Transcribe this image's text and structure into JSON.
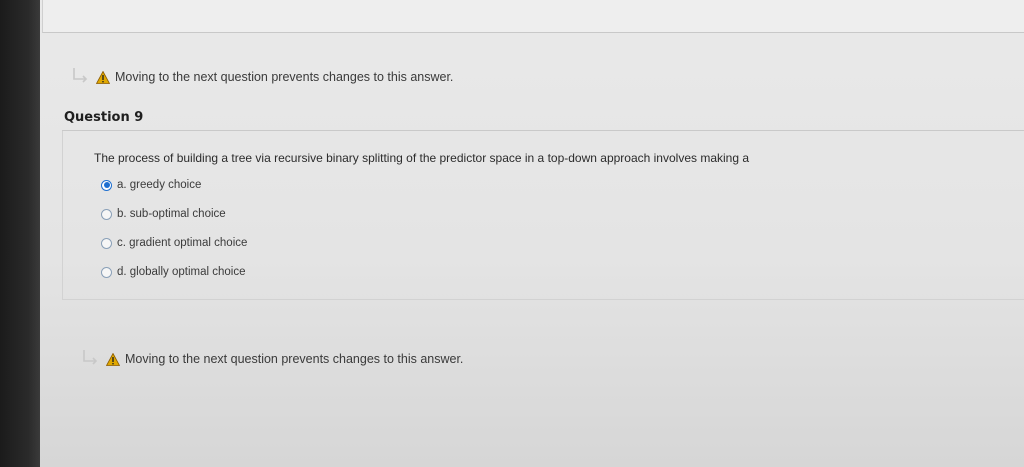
{
  "warning": {
    "text": "Moving to the next question prevents changes to this answer."
  },
  "question": {
    "title": "Question 9",
    "prompt": "The process of building a tree via recursive binary splitting of the predictor space in a top-down approach involves making a",
    "options": [
      {
        "label": "a. greedy choice",
        "selected": true
      },
      {
        "label": "b. sub-optimal choice",
        "selected": false
      },
      {
        "label": "c. gradient optimal choice",
        "selected": false
      },
      {
        "label": "d. globally optimal choice",
        "selected": false
      }
    ]
  },
  "colors": {
    "accent": "#1e6fd0",
    "warning": "#e0a800"
  }
}
